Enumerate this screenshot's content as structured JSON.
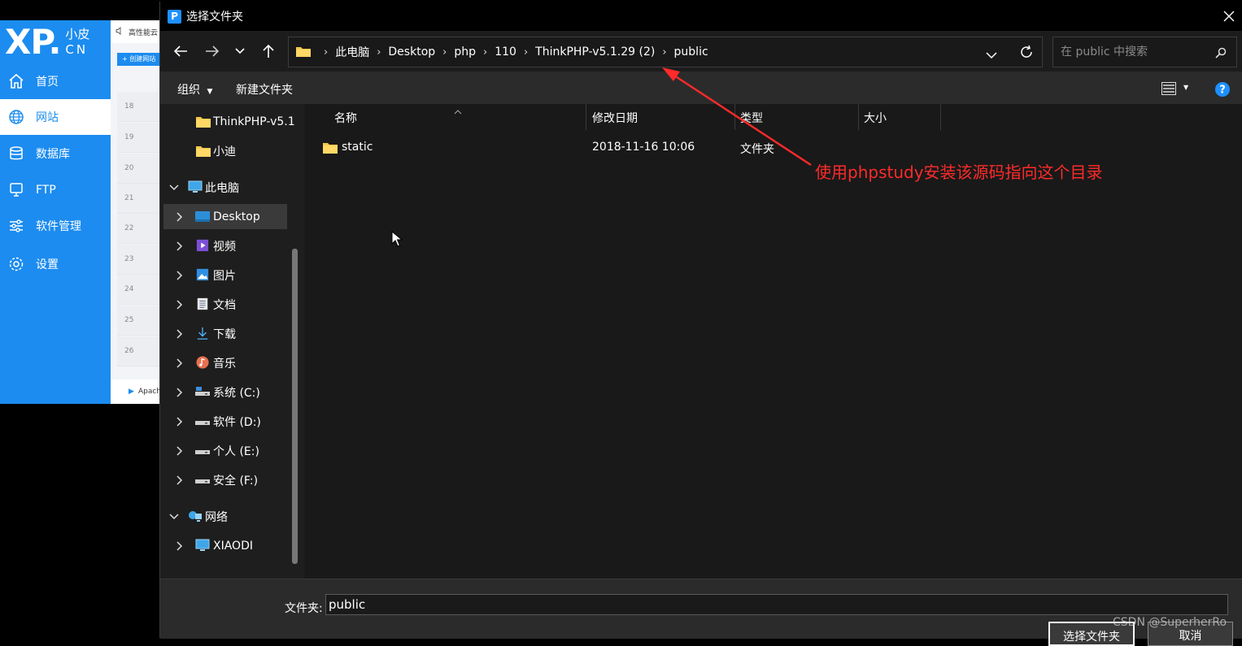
{
  "background_app": {
    "logo_text": "XP.",
    "logo_sub_1": "小皮",
    "logo_sub_2": "CN",
    "nav_items": [
      {
        "label": "首页",
        "icon": "home-icon"
      },
      {
        "label": "网站",
        "icon": "globe-icon",
        "active": true
      },
      {
        "label": "数据库",
        "icon": "database-icon"
      },
      {
        "label": "FTP",
        "icon": "server-icon"
      },
      {
        "label": "软件管理",
        "icon": "sliders-icon"
      },
      {
        "label": "设置",
        "icon": "gear-icon"
      }
    ],
    "topbar_text": "高性能云",
    "create_site_label": "+ 创建网站",
    "row_numbers": [
      "18",
      "19",
      "20",
      "21",
      "22",
      "23",
      "24",
      "25",
      "26"
    ],
    "footer_text": "Apach"
  },
  "dialog": {
    "title": "选择文件夹",
    "app_icon_letter": "P",
    "breadcrumb": [
      "此电脑",
      "Desktop",
      "php",
      "110",
      "ThinkPHP-v5.1.29 (2)",
      "public"
    ],
    "search_placeholder": "在 public 中搜索",
    "toolbar": {
      "organize_label": "组织",
      "new_folder_label": "新建文件夹"
    },
    "nav_tree": [
      {
        "label": "ThinkPHP-v5.1",
        "icon": "folder-icon"
      },
      {
        "label": "小迪",
        "icon": "folder-icon"
      },
      {
        "label": "此电脑",
        "icon": "computer-icon"
      },
      {
        "label": "Desktop",
        "icon": "desktop-icon"
      },
      {
        "label": "视频",
        "icon": "video-icon"
      },
      {
        "label": "图片",
        "icon": "picture-icon"
      },
      {
        "label": "文档",
        "icon": "document-icon"
      },
      {
        "label": "下载",
        "icon": "download-icon"
      },
      {
        "label": "音乐",
        "icon": "music-icon"
      },
      {
        "label": "系统 (C:)",
        "icon": "drive-icon"
      },
      {
        "label": "软件 (D:)",
        "icon": "drive-icon"
      },
      {
        "label": "个人 (E:)",
        "icon": "drive-icon"
      },
      {
        "label": "安全 (F:)",
        "icon": "drive-icon"
      },
      {
        "label": "网络",
        "icon": "network-icon"
      },
      {
        "label": "XIAODI",
        "icon": "computer-icon"
      }
    ],
    "columns": [
      "名称",
      "修改日期",
      "类型",
      "大小"
    ],
    "files": [
      {
        "name": "static",
        "modified": "2018-11-16 10:06",
        "type": "文件夹",
        "size": ""
      }
    ],
    "folder_label": "文件夹:",
    "folder_value": "public",
    "select_button": "选择文件夹",
    "cancel_button": "取消"
  },
  "annotation_text": "使用phpstudy安装该源码指向这个目录",
  "watermark": "CSDN @SuperherRo",
  "colors": {
    "accent_blue": "#1c8cf0",
    "annotation_red": "#ff2a2a",
    "dialog_bg": "#1c1c1c"
  }
}
